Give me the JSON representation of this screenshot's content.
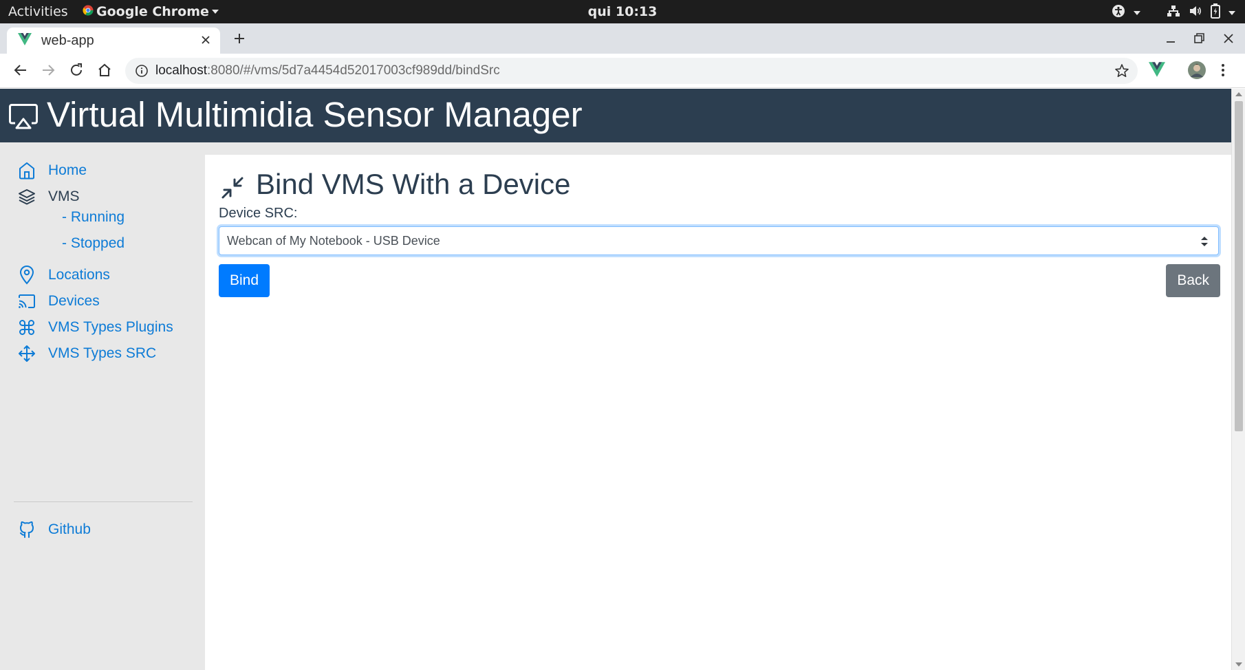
{
  "system_bar": {
    "activities": "Activities",
    "app_name": "Google Chrome",
    "clock": "qui 10:13"
  },
  "browser": {
    "tab_title": "web-app",
    "url_host": "localhost",
    "url_path": ":8080/#/vms/5d7a4454d52017003cf989dd/bindSrc"
  },
  "app": {
    "title": "Virtual Multimidia Sensor Manager",
    "sidebar": {
      "home": "Home",
      "vms": "VMS",
      "running": "- Running",
      "stopped": "- Stopped",
      "locations": "Locations",
      "devices": "Devices",
      "vms_types_plugins": "VMS Types Plugins",
      "vms_types_src": "VMS Types SRC",
      "github": "Github"
    },
    "main": {
      "heading": "Bind VMS With a Device",
      "field_label": "Device SRC:",
      "selected_device": "Webcan of My Notebook - USB Device",
      "bind_button": "Bind",
      "back_button": "Back"
    }
  },
  "colors": {
    "header_bg": "#2c3e50",
    "link": "#0d7bd6",
    "primary": "#007bff",
    "secondary": "#6c757d"
  }
}
